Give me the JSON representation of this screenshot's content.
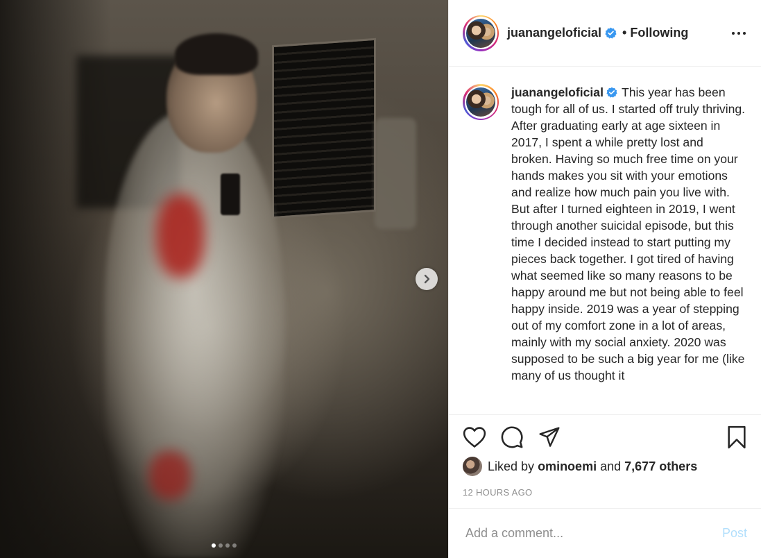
{
  "post": {
    "username": "juanangeloficial",
    "following_label": "Following",
    "separator": "•",
    "caption": "This year has been tough for all of us. I started off truly thriving. After graduating early at age sixteen in 2017, I spent a while pretty lost and broken. Having so much free time on your hands makes you sit with your emotions and realize how much pain you live with. But after I turned eighteen in 2019, I went through another suicidal episode, but this time I decided instead to start putting my pieces back together. I got tired of having what seemed like so many reasons to be happy around me but not being able to feel happy inside. 2019 was a year of stepping out of my comfort zone in a lot of areas, mainly with my social anxiety. 2020 was supposed to be such a big year for me (like many of us thought it",
    "likes": {
      "prefix": "Liked by",
      "user": "ominoemi",
      "conjunction": "and",
      "others": "7,677 others"
    },
    "timestamp": "12 HOURS AGO",
    "comment": {
      "placeholder": "Add a comment...",
      "post_label": "Post"
    }
  },
  "carousel": {
    "total": 4,
    "active": 1
  },
  "icons": {
    "verified": "verified-badge-icon",
    "more": "more-options-icon",
    "like": "heart-icon",
    "comment": "comment-bubble-icon",
    "share": "paper-plane-icon",
    "save": "bookmark-icon",
    "next": "chevron-right-icon"
  },
  "colors": {
    "verified_blue": "#3897f0",
    "text": "#262626",
    "muted": "#8e8e8e",
    "post_disabled": "#b2dffc",
    "divider": "#efefef"
  }
}
